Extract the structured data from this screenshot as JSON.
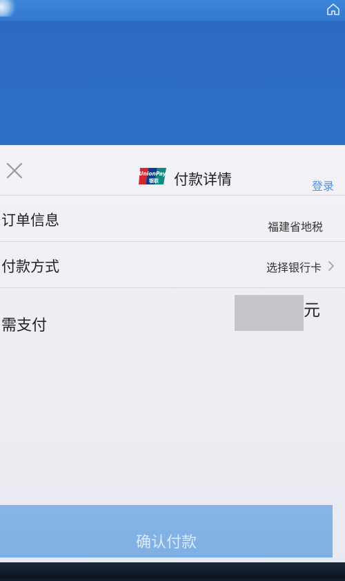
{
  "header": {
    "title": "付款详情",
    "login_label": "登录",
    "logo_text": "UnionPay 银联"
  },
  "order_row": {
    "label": "订单信息",
    "value": "福建省地税"
  },
  "payment_method_row": {
    "label": "付款方式",
    "value": "选择银行卡"
  },
  "amount_row": {
    "label": "需支付",
    "unit": "元"
  },
  "confirm_button": {
    "label": "确认付款"
  },
  "colors": {
    "accent": "#4f90e0",
    "button": "#86b4e6",
    "background_blue": "#2f73c9"
  }
}
